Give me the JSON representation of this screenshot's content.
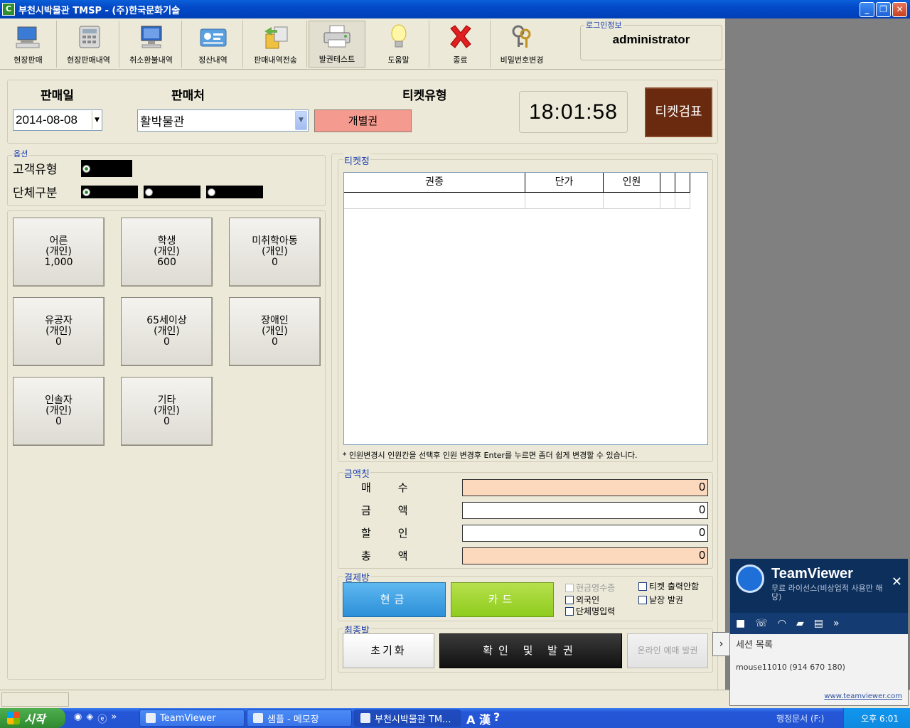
{
  "window": {
    "title": "부천시박물관 TMSP - (주)한국문화기술",
    "minimize": "_",
    "restore": "❐",
    "close": "✕"
  },
  "toolbar": {
    "items": [
      {
        "label": "현장판매",
        "icon": "computer-icon"
      },
      {
        "label": "현장판매내역",
        "icon": "calculator-icon"
      },
      {
        "label": "취소환불내역",
        "icon": "monitor-icon"
      },
      {
        "label": "정산내역",
        "icon": "settlement-icon"
      },
      {
        "label": "판매내역전송",
        "icon": "transfer-icon"
      },
      {
        "label": "발권테스트",
        "icon": "printer-icon"
      },
      {
        "label": "도움말",
        "icon": "lightbulb-icon"
      },
      {
        "label": "종료",
        "icon": "exit-x-icon"
      },
      {
        "label": "비밀번호변경",
        "icon": "keys-icon"
      }
    ],
    "login_legend": "로그인정보",
    "login_user": "administrator"
  },
  "sale": {
    "date_label": "판매일",
    "date_value": "2014-08-08",
    "seller_label": "판매처",
    "seller_value": "활박물관",
    "ticket_type_label": "티켓유형",
    "ticket_type_value": "개별권",
    "clock": "18:01:58",
    "check_button": "티켓검표"
  },
  "options": {
    "legend": "옵션",
    "customer_type_label": "고객유형",
    "group_label": "단체구분"
  },
  "tickets": [
    {
      "name": "어른",
      "type": "(개인)",
      "price": "1,000"
    },
    {
      "name": "학생",
      "type": "(개인)",
      "price": "600"
    },
    {
      "name": "미취학아동",
      "type": "(개인)",
      "price": "0"
    },
    {
      "name": "유공자",
      "type": "(개인)",
      "price": "0"
    },
    {
      "name": "65세이상",
      "type": "(개인)",
      "price": "0"
    },
    {
      "name": "장애인",
      "type": "(개인)",
      "price": "0"
    },
    {
      "name": "인솔자",
      "type": "(개인)",
      "price": "0"
    },
    {
      "name": "기타",
      "type": "(개인)",
      "price": "0"
    }
  ],
  "ticket_info": {
    "legend": "티켓정",
    "columns": [
      "권종",
      "단가",
      "인원",
      "",
      ""
    ],
    "hint": "* 인원변경시 인원칸을 선택후 인원 변경후 Enter를 누르면 좀더 쉽게 변경할 수 있습니다."
  },
  "amounts": {
    "legend": "금액칫",
    "rows": [
      {
        "label": "매수",
        "value": "0"
      },
      {
        "label": "금액",
        "value": "0"
      },
      {
        "label": "할인",
        "value": "0"
      },
      {
        "label": "총액",
        "value": "0"
      }
    ]
  },
  "payment": {
    "legend": "결제방",
    "cash": "현금",
    "card": "카드",
    "cash_receipt": "현금영수증",
    "foreigner": "외국인",
    "group_name_input": "단체명입력",
    "no_ticket_print": "티켓 출력안함",
    "individual_issue": "낱장 발권"
  },
  "final": {
    "legend": "최종발",
    "reset": "초기화",
    "confirm": "확인 및 발권",
    "online": "온라인 예매 발권"
  },
  "teamviewer": {
    "name": "TeamViewer",
    "license": "무료 라이선스(비상업적 사용만 해당)",
    "close": "✕",
    "sessions_label": "세션 목록",
    "session_item": "mouse11010 (914 670 180)",
    "link": "www.teamviewer.com",
    "side_arrow": "›"
  },
  "taskbar": {
    "start": "시작",
    "tasks": [
      "TeamViewer",
      "샘플 - 메모장",
      "부천시박물관 TM..."
    ],
    "ime": "A 漢",
    "drive": "행정문서 (F:)",
    "clock": "오후 6:01"
  },
  "colors": {
    "accent": "#0349c7",
    "peach": "#fcd8bd",
    "cash": "#2c8fd8",
    "card": "#8fcc1e",
    "confirm": "#1e1e1e",
    "check": "#6a2a0f"
  }
}
